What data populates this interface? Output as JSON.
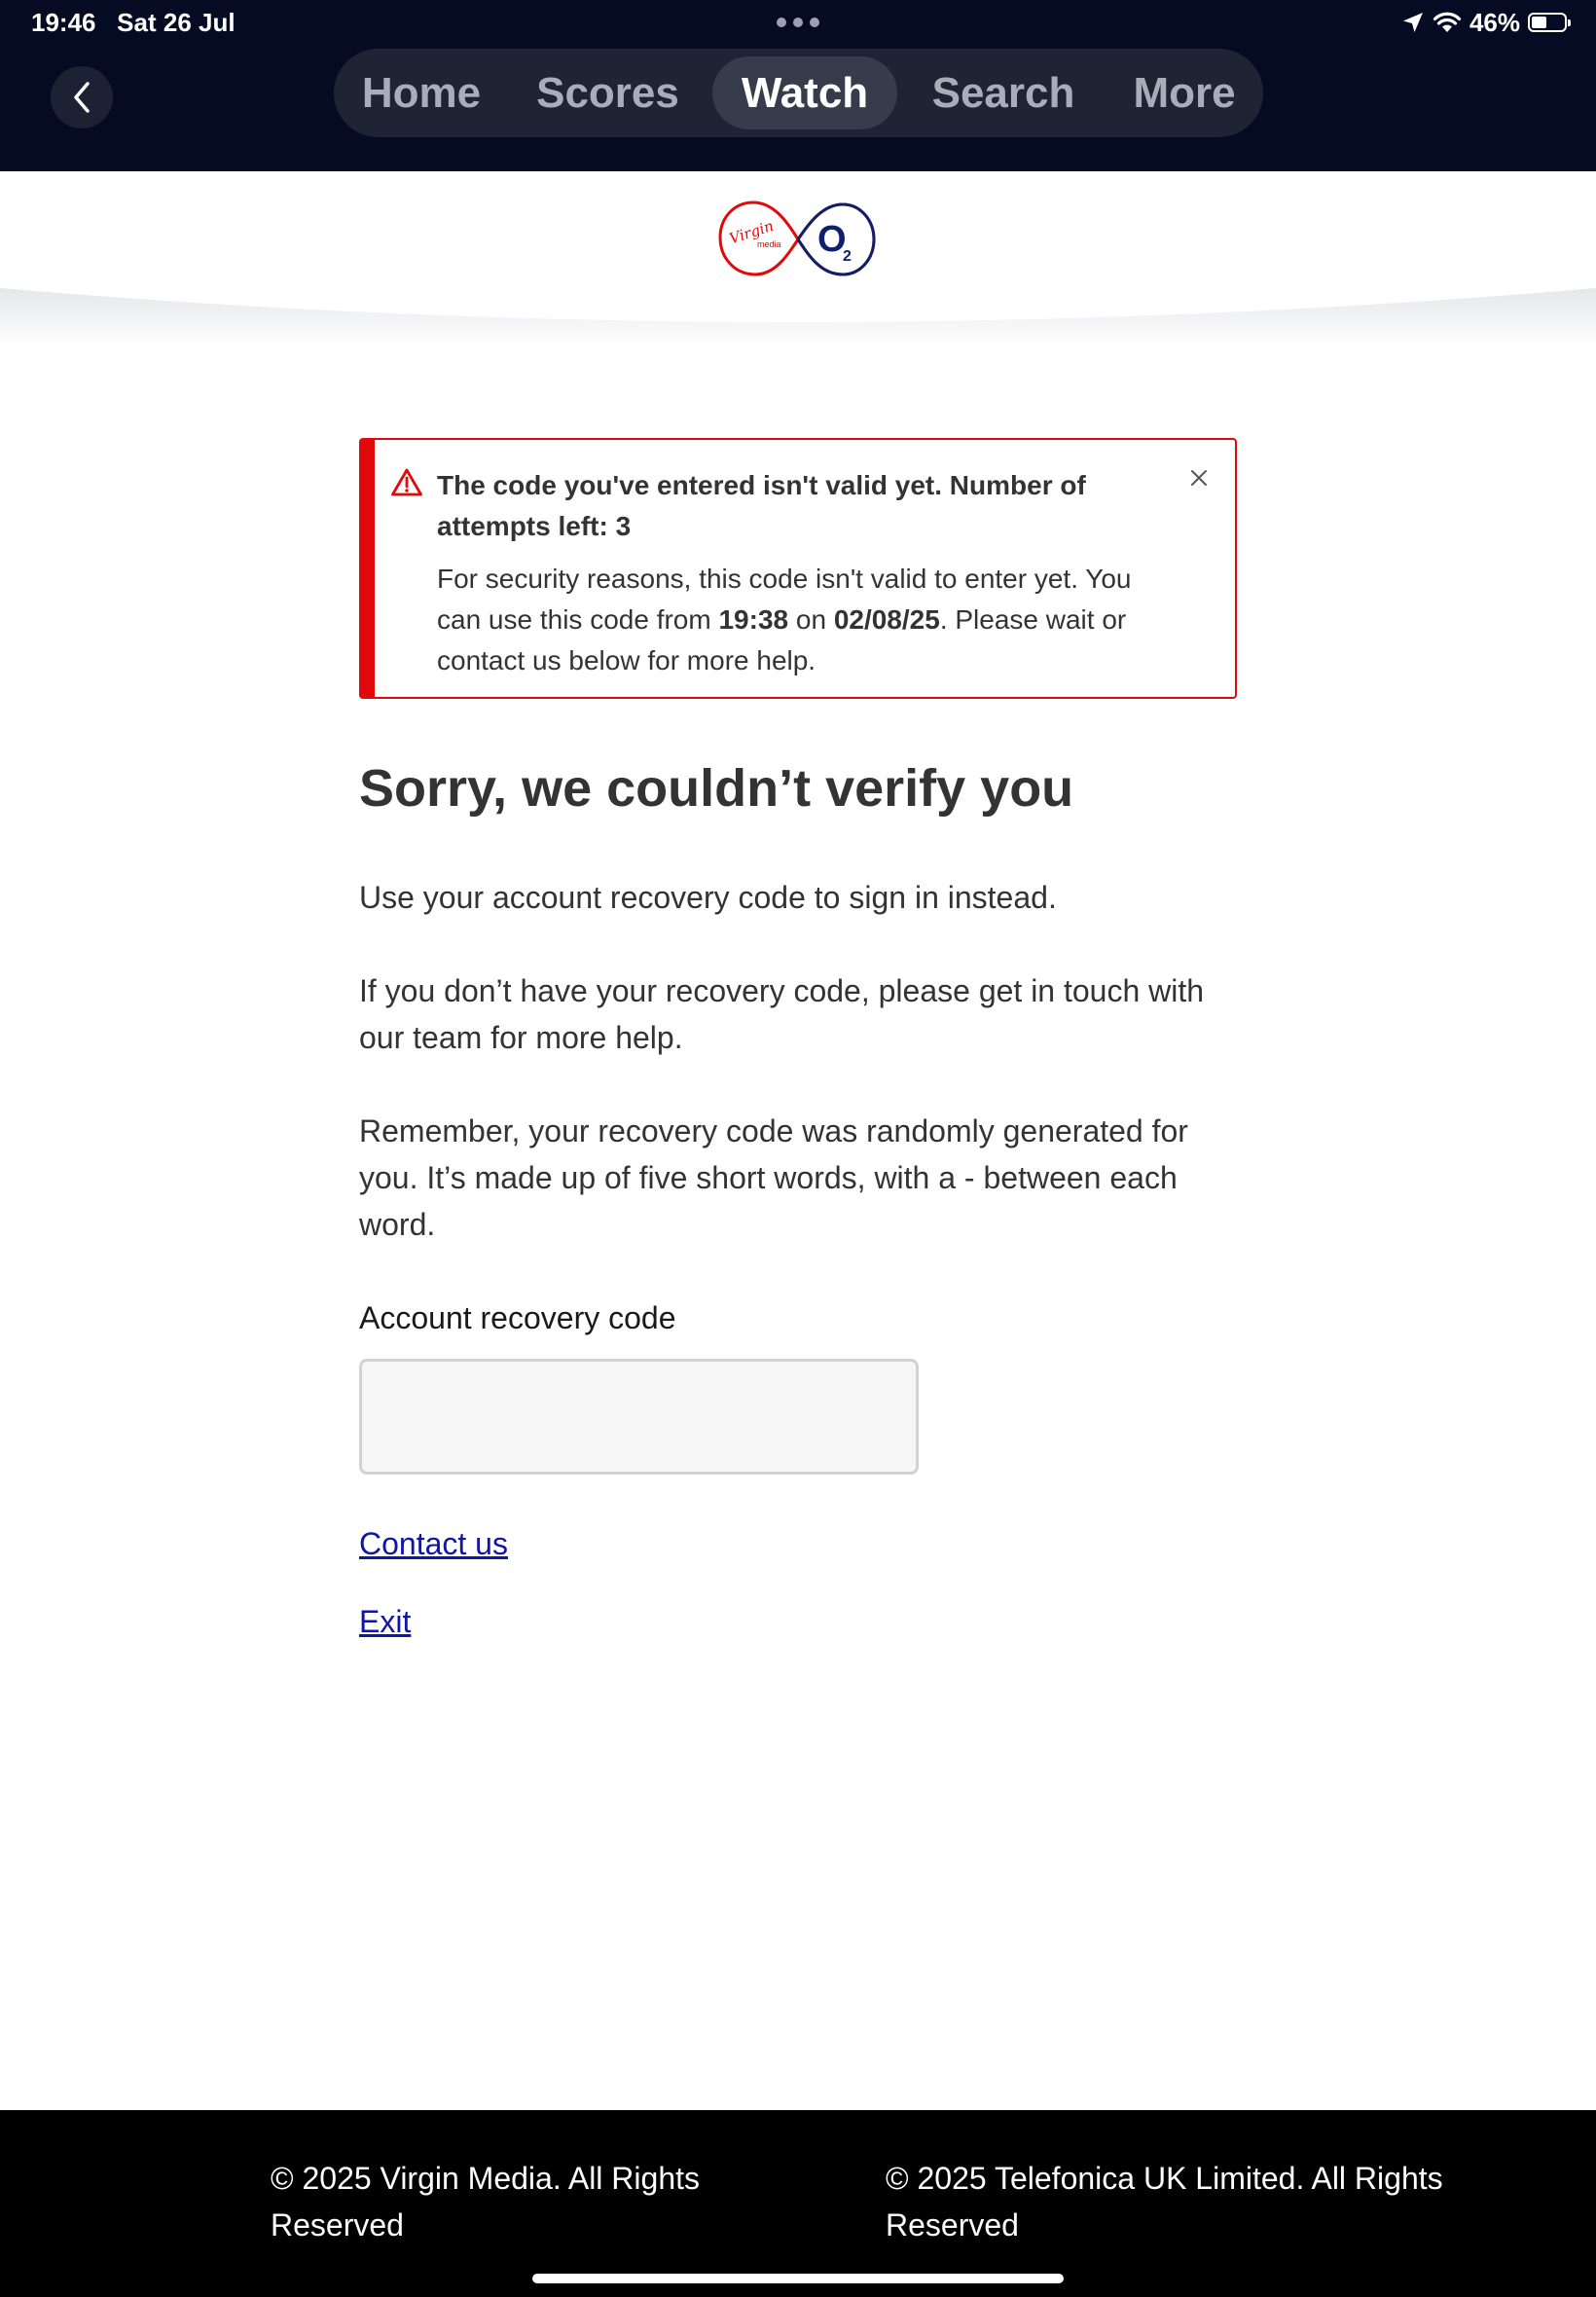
{
  "status_bar": {
    "time": "19:46",
    "date": "Sat 26 Jul",
    "battery_text": "46%",
    "battery_level": 0.46
  },
  "nav": {
    "tabs": [
      {
        "label": "Home",
        "active": false
      },
      {
        "label": "Scores",
        "active": false
      },
      {
        "label": "Watch",
        "active": true
      },
      {
        "label": "Search",
        "active": false
      },
      {
        "label": "More",
        "active": false
      }
    ],
    "back_icon": "chevron-left-icon"
  },
  "brand": {
    "virgin_text": "Virgin",
    "media_text": "media",
    "o2_text": "O",
    "o2_sub": "2",
    "virgin_color": "#e10a0a",
    "o2_color": "#0e1f6b"
  },
  "alert": {
    "title": "The code you've entered isn't valid yet. Number of attempts left: 3",
    "body_part1": "For security reasons, this code isn't valid to enter yet. You can use this code from ",
    "body_time": "19:38",
    "body_part2": " on ",
    "body_date": "02/08/25",
    "body_part3": ". Please wait or contact us below for more help.",
    "icon": "warning-icon",
    "close_icon": "close-icon",
    "color": "#e10a0a"
  },
  "main": {
    "heading": "Sorry, we couldn’t verify you",
    "para1": "Use your account recovery code to sign in instead.",
    "para2": "If you don’t have your recovery code, please get in touch with our team for more help.",
    "para3": "Remember, your recovery code was randomly generated for you. It’s made up of five short words, with a - between each word.",
    "field_label": "Account recovery code",
    "field_value": "",
    "contact_link": "Contact us",
    "exit_link": "Exit",
    "link_color": "#0f16a6"
  },
  "footer": {
    "left": "© 2025 Virgin Media. All Rights Reserved",
    "right": "© 2025 Telefonica UK Limited. All Rights Reserved"
  }
}
